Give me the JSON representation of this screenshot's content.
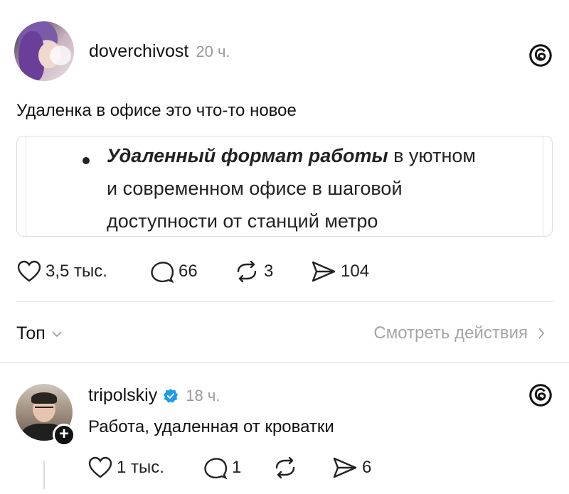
{
  "post": {
    "username": "doverchivost",
    "time": "20 ч.",
    "text": "Удаленка в офисе это что-то новое",
    "quote": {
      "bold_part": "Удаленный формат работы",
      "line1_rest": " в уютном",
      "line2": "и современном офисе в шаговой",
      "line3": "доступности от станций метро"
    },
    "actions": {
      "likes": "3,5 тыс.",
      "comments": "66",
      "reposts": "3",
      "shares": "104"
    }
  },
  "replies_bar": {
    "sort_label": "Топ",
    "view_actions": "Смотреть действия"
  },
  "reply": {
    "username": "tripolskiy",
    "time": "18 ч.",
    "text": "Работа, удаленная от кроватки",
    "actions": {
      "likes": "1 тыс.",
      "comments": "1",
      "reposts": "",
      "shares": "6"
    }
  },
  "colors": {
    "verified": "#1d9bf0",
    "muted": "#9a9a9a"
  }
}
